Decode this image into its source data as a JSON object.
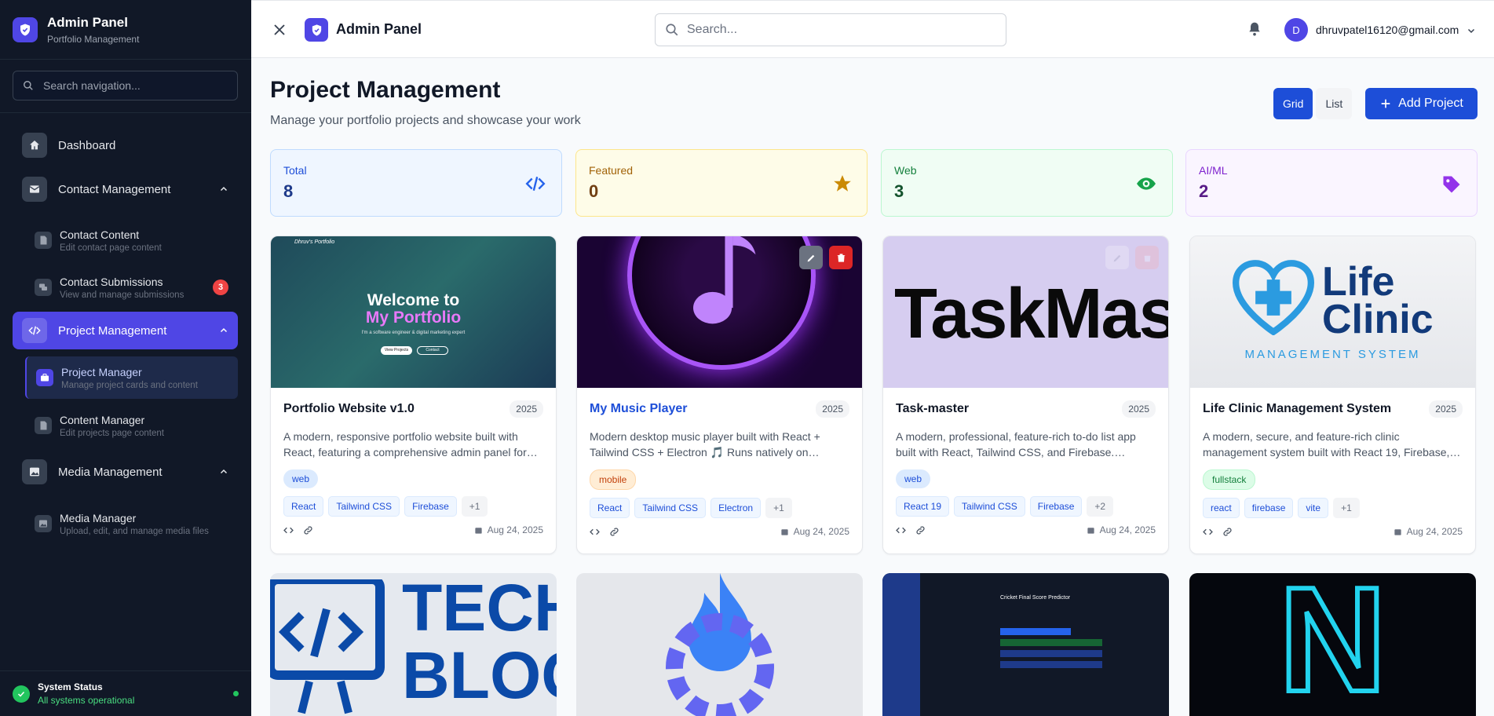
{
  "sidebar": {
    "title": "Admin Panel",
    "subtitle": "Portfolio Management",
    "search_placeholder": "Search navigation...",
    "nav": {
      "dashboard": "Dashboard",
      "contact": "Contact Management",
      "contact_content": {
        "title": "Contact Content",
        "desc": "Edit contact page content"
      },
      "contact_submissions": {
        "title": "Contact Submissions",
        "desc": "View and manage submissions",
        "badge": "3"
      },
      "project": "Project Management",
      "project_manager": {
        "title": "Project Manager",
        "desc": "Manage project cards and content"
      },
      "content_manager": {
        "title": "Content Manager",
        "desc": "Edit projects page content"
      },
      "media": "Media Management",
      "media_manager": {
        "title": "Media Manager",
        "desc": "Upload, edit, and manage media files"
      }
    },
    "status": {
      "title": "System Status",
      "text": "All systems operational"
    }
  },
  "topbar": {
    "title": "Admin Panel",
    "search_placeholder": "Search...",
    "avatar_initial": "D",
    "user_email": "dhruvpatel16120@gmail.com"
  },
  "page": {
    "title": "Project Management",
    "subtitle": "Manage your portfolio projects and showcase your work",
    "view_grid": "Grid",
    "view_list": "List",
    "add_button": "Add Project"
  },
  "stats": [
    {
      "label": "Total",
      "value": "8",
      "icon": "code-icon"
    },
    {
      "label": "Featured",
      "value": "0",
      "icon": "star-icon"
    },
    {
      "label": "Web",
      "value": "3",
      "icon": "eye-icon"
    },
    {
      "label": "AI/ML",
      "value": "2",
      "icon": "tag-icon"
    }
  ],
  "projects": [
    {
      "title": "Portfolio Website v1.0",
      "year": "2025",
      "desc": "A modern, responsive portfolio website built with React, featuring a comprehensive admin panel for…",
      "category": "web",
      "tags": [
        "React",
        "Tailwind CSS",
        "Firebase"
      ],
      "more": "+1",
      "date": "Aug 24, 2025",
      "img": {
        "nav_brand": "Dhruv's Portfolio",
        "line1": "Welcome to",
        "line2": "My Portfolio",
        "tagline": "I'm a software engineer & digital marketing expert",
        "btn1": "View Projects",
        "btn2": "Contact"
      }
    },
    {
      "title": "My Music Player",
      "year": "2025",
      "desc": "Modern desktop music player built with React + Tailwind CSS + Electron 🎵 Runs natively on…",
      "category": "mobile",
      "tags": [
        "React",
        "Tailwind CSS",
        "Electron"
      ],
      "more": "+1",
      "date": "Aug 24, 2025"
    },
    {
      "title": "Task-master",
      "year": "2025",
      "desc": "A modern, professional, feature-rich to-do list app built with React, Tailwind CSS, and Firebase.…",
      "category": "web",
      "tags": [
        "React 19",
        "Tailwind CSS",
        "Firebase"
      ],
      "more": "+2",
      "date": "Aug 24, 2025",
      "img": {
        "text": "TaskMaster"
      }
    },
    {
      "title": "Life Clinic Management System",
      "year": "2025",
      "desc": "A modern, secure, and feature-rich clinic management system built with React 19, Firebase,…",
      "category": "fullstack",
      "tags": [
        "react",
        "firebase",
        "vite"
      ],
      "more": "+1",
      "date": "Aug 24, 2025",
      "img": {
        "line1": "Life",
        "line2": "Clinic",
        "line3": "MANAGEMENT SYSTEM"
      }
    }
  ],
  "lower_cards": [
    {
      "img": {
        "line1": "TECH",
        "line2": "BLOG"
      }
    },
    {
      "img": {}
    },
    {
      "img": {
        "heading": "Cricket Final Score Predictor"
      }
    },
    {
      "img": {
        "letter": "N"
      }
    }
  ],
  "colors": {
    "accent": "#4f46e5",
    "primary": "#1d4ed8",
    "sidebar": "#111827"
  }
}
